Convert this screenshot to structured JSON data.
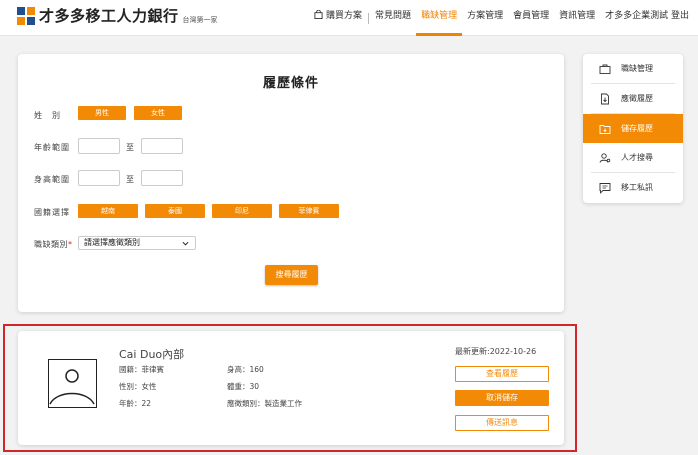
{
  "brand": {
    "name": "才多多移工人力銀行",
    "tagline": "台灣第一家"
  },
  "nav": {
    "items": [
      {
        "label": "購買方案"
      },
      {
        "label": "常見問題"
      },
      {
        "label": "職缺管理"
      },
      {
        "label": "方案管理"
      },
      {
        "label": "會員管理"
      },
      {
        "label": "資訊管理"
      },
      {
        "label": "才多多企業測試 登出"
      }
    ],
    "active_label": "職缺管理"
  },
  "filter": {
    "title": "履歷條件",
    "gender_label": "姓　別",
    "gender_options": [
      "男性",
      "女性"
    ],
    "age_label": "年齡範圍",
    "height_label": "身高範圍",
    "range_to": "至",
    "nationality_label": "國籍選擇",
    "nationality_options": [
      "越南",
      "泰國",
      "印尼",
      "菲律賓"
    ],
    "job_type_label": "職缺類別",
    "required_mark": "*",
    "job_type_select": "請選擇應徵類別",
    "search_button": "搜尋履歷"
  },
  "side_menu": {
    "items": [
      {
        "label": "職缺管理",
        "icon": "briefcase-icon"
      },
      {
        "label": "應徵履歷",
        "icon": "download-doc-icon"
      },
      {
        "label": "儲存履歷",
        "icon": "folder-save-icon"
      },
      {
        "label": "人才搜尋",
        "icon": "people-search-icon"
      },
      {
        "label": "移工私訊",
        "icon": "chat-icon"
      }
    ],
    "active_label": "儲存履歷"
  },
  "result": {
    "name": "Cai Duo內部",
    "nationality": "國籍：菲律賓",
    "gender": "性別：女性",
    "age": "年齡：22",
    "height": "身高：160",
    "weight": "體重：30",
    "job_type": "應徵類別：製造業工作",
    "updated": "最新更新:2022-10-26",
    "view_button": "查看履歷",
    "unsave_button": "取消儲存",
    "message_button": "傳送訊息"
  },
  "colors": {
    "accent": "#f28a06",
    "highlight_border": "#d0262c"
  }
}
